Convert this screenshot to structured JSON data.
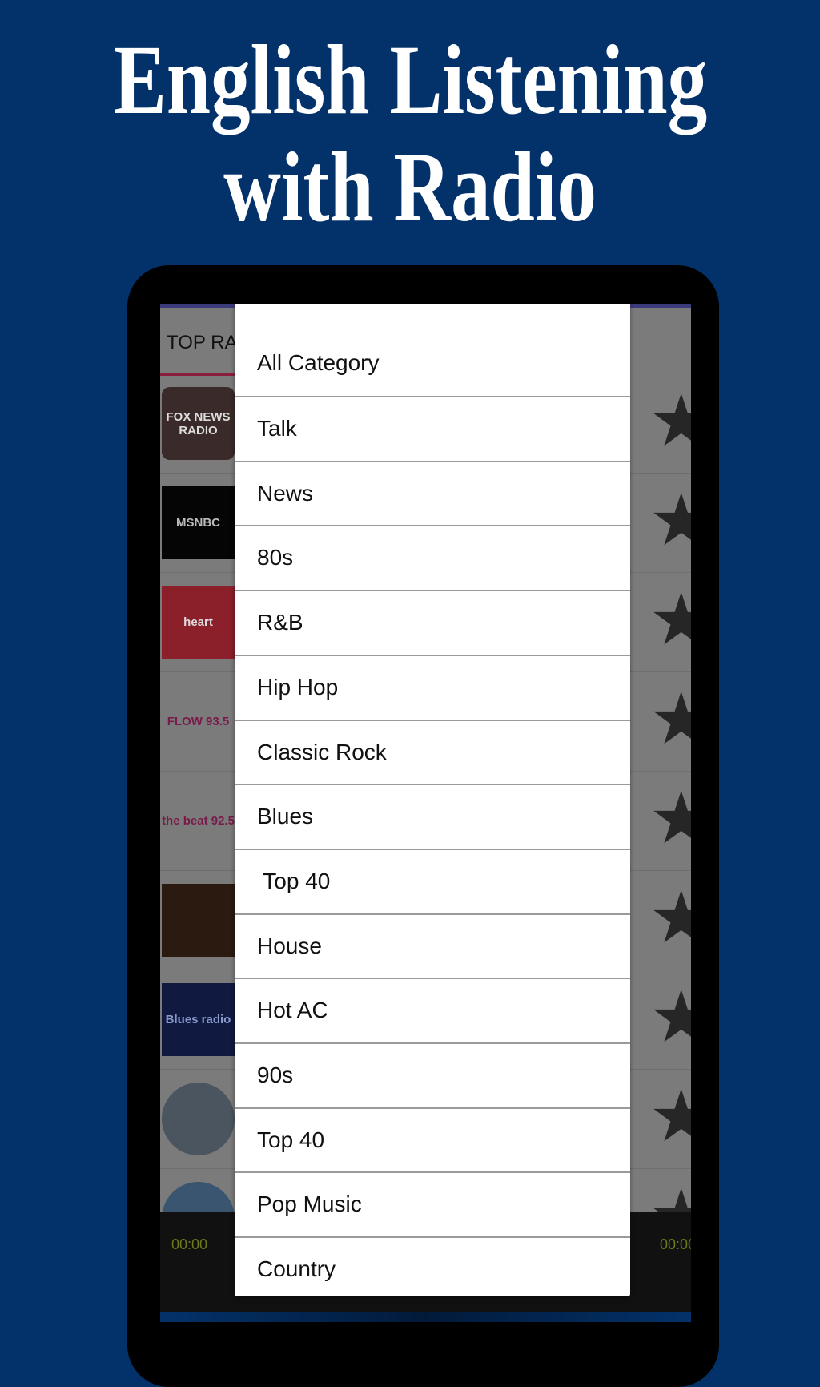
{
  "headline": {
    "line1": "English Listening",
    "line2": "with Radio"
  },
  "colors": {
    "background": "#03326a",
    "tab_underline": "#8a1f3c",
    "timer": "#6d7a16",
    "dialog": "#ffffff"
  },
  "app": {
    "tab_label": "TOP RA",
    "stations": [
      {
        "logo": "FOX NEWS RADIO",
        "bg": "#3a2a2a",
        "fg": "#ddd",
        "icon": "star-icon"
      },
      {
        "logo": "MSNBC",
        "bg": "#050505",
        "fg": "#bbb",
        "icon": "star-icon"
      },
      {
        "logo": "heart",
        "bg": "#8b1f2a",
        "fg": "#ddd",
        "icon": "star-icon"
      },
      {
        "logo": "FLOW 93.5",
        "bg": "#7b7b7b",
        "fg": "#7a1a4a",
        "icon": "star-icon"
      },
      {
        "logo": "the beat 92.5",
        "bg": "#7b7b7b",
        "fg": "#7a1a4a",
        "icon": "star-icon"
      },
      {
        "logo": "",
        "bg": "#2a1a10",
        "fg": "#aaa",
        "icon": "star-icon"
      },
      {
        "logo": "Blues radio",
        "bg": "#101a40",
        "fg": "#8899cc",
        "icon": "star-icon"
      },
      {
        "logo": "",
        "bg": "#4a5560",
        "fg": "#aaa",
        "icon": "star-icon"
      },
      {
        "logo": "",
        "bg": "#3a5570",
        "fg": "#aaa",
        "icon": "star-icon"
      }
    ],
    "player": {
      "elapsed": "00:00",
      "duration": "00:00"
    }
  },
  "category_dialog": {
    "items": [
      "All Category",
      "Talk",
      "News",
      "80s",
      "R&B",
      "Hip Hop",
      "Classic Rock",
      "Blues",
      " Top 40",
      "House",
      "Hot AC",
      "90s",
      "Top 40",
      "Pop Music",
      "Country"
    ]
  }
}
